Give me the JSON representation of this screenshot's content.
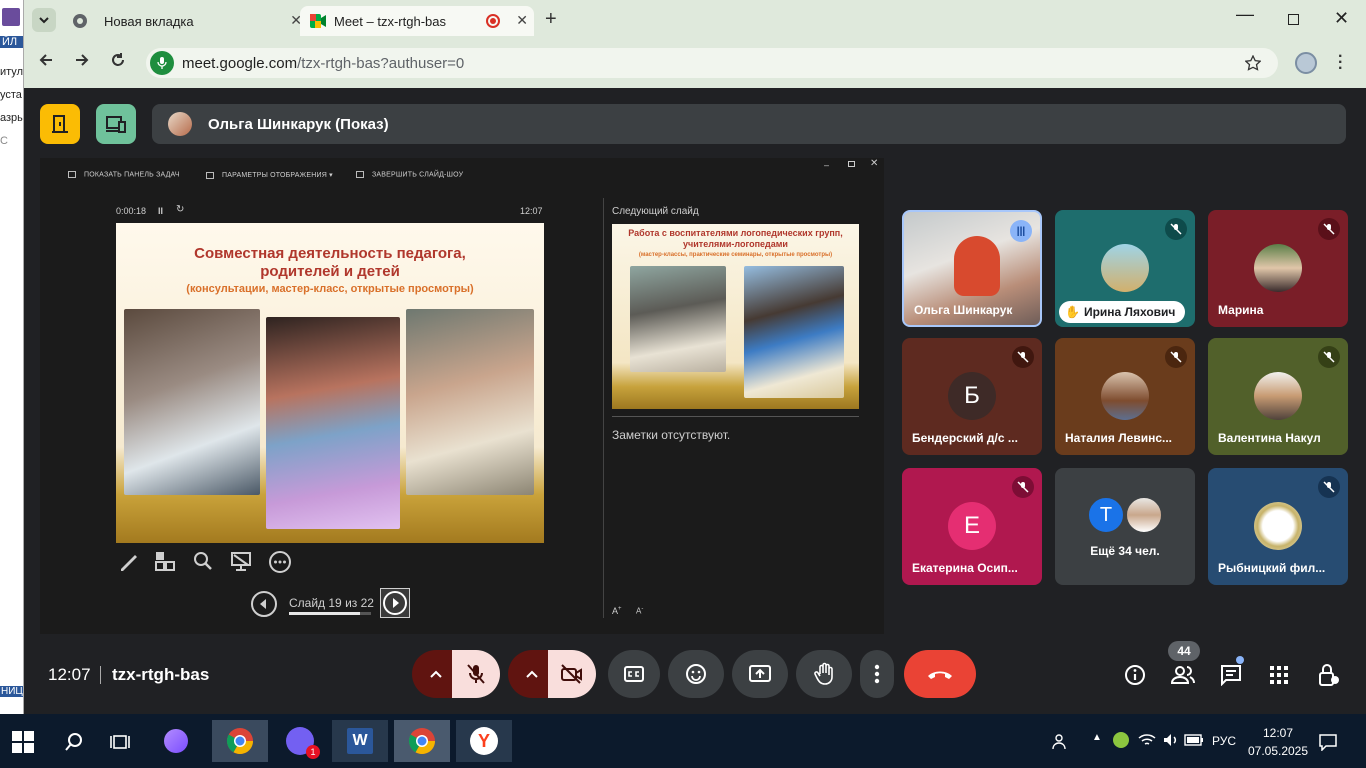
{
  "background_window": {
    "lines": [
      "ЙЛ",
      "итул",
      "уста",
      "азры",
      "С",
      "НИЦА"
    ]
  },
  "browser": {
    "tabs": [
      {
        "title": "Новая вкладка",
        "active": false
      },
      {
        "title": "Meet – tzx-rtgh-bas",
        "active": true,
        "recording": true
      }
    ],
    "url_host": "meet.google.com",
    "url_path": "/tzx-rtgh-bas?authuser=0"
  },
  "meet": {
    "presenter_label": "Ольга Шинкарук (Показ)",
    "presentation": {
      "toolbar": [
        "ПОКАЗАТЬ ПАНЕЛЬ ЗАДАЧ",
        "ПАРАМЕТРЫ ОТОБРАЖЕНИЯ ▾",
        "ЗАВЕРШИТЬ СЛАЙД-ШОУ"
      ],
      "elapsed": "0:00:18",
      "clock": "12:07",
      "slide_title": "Совместная деятельность педагога, родителей и детей",
      "slide_subtitle": "(консультации, мастер-класс, открытые просмотры)",
      "next_slide_label": "Следующий слайд",
      "next_slide_title": "Работа с воспитателями логопедических групп, учителями-логопедами",
      "next_slide_subtitle": "(мастер-классы, практические семинары, открытые просмотры)",
      "notes": "Заметки отсутствуют.",
      "slide_counter": "Слайд 19 из 22",
      "progress": 0.86
    },
    "participants": [
      {
        "name": "Ольга Шинкарук",
        "speaking": true
      },
      {
        "name": "Ирина Ляхович",
        "muted": true,
        "hand_raised": true
      },
      {
        "name": "Марина",
        "muted": true
      },
      {
        "name": "Бендерский д/с ...",
        "initial": "Б",
        "muted": true
      },
      {
        "name": "Наталия Левинс...",
        "muted": true
      },
      {
        "name": "Валентина Накул",
        "muted": true
      },
      {
        "name": "Екатерина Осип...",
        "initial": "Е",
        "muted": true
      },
      {
        "name": "Ещё 34 чел.",
        "initial": "Т"
      },
      {
        "name": "Рыбницкий фил...",
        "muted": true
      }
    ],
    "meeting_time": "12:07",
    "meeting_code": "tzx-rtgh-bas",
    "participants_count": "44"
  },
  "taskbar": {
    "lang": "РУС",
    "time": "12:07",
    "date": "07.05.2025",
    "viber_badge": "1"
  },
  "colors": {
    "end_call": "#ea4335",
    "accent_yellow": "#fbbc04",
    "accent_green": "#6fc29b",
    "chrome_bg": "#dfe9dc"
  }
}
